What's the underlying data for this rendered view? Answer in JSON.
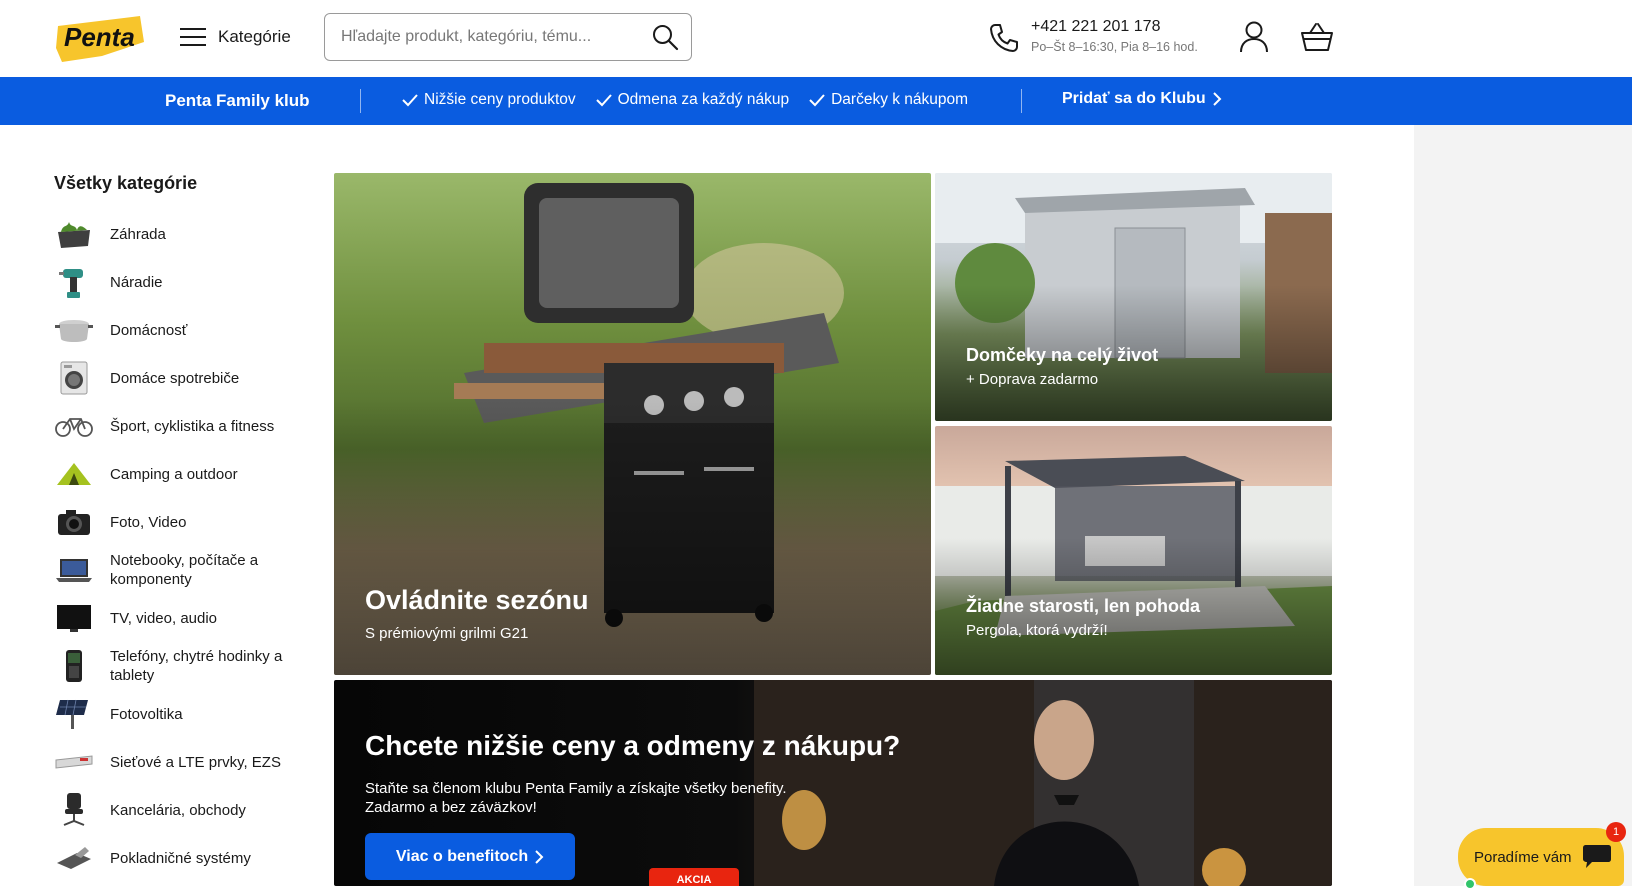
{
  "header": {
    "logo_text": "Penta",
    "menu_label": "Kategórie",
    "search_placeholder": "Hľadajte produkt, kategóriu, tému...",
    "phone_number": "+421 221 201 178",
    "phone_hours": "Po–Št 8–16:30, Pia 8–16 hod."
  },
  "club_bar": {
    "title": "Penta Family klub",
    "benefits": [
      "Nižšie ceny produktov",
      "Odmena za každý nákup",
      "Darčeky k nákupom"
    ],
    "join_label": "Pridať sa do Klubu"
  },
  "sidebar": {
    "title": "Všetky kategórie",
    "items": [
      {
        "label": "Záhrada",
        "icon": "garden-planter-icon"
      },
      {
        "label": "Náradie",
        "icon": "drill-icon"
      },
      {
        "label": "Domácnosť",
        "icon": "pot-icon"
      },
      {
        "label": "Domáce spotrebiče",
        "icon": "washing-machine-icon"
      },
      {
        "label": "Šport, cyklistika a fitness",
        "icon": "bicycle-icon"
      },
      {
        "label": "Camping a outdoor",
        "icon": "tent-icon"
      },
      {
        "label": "Foto, Video",
        "icon": "camera-icon"
      },
      {
        "label": "Notebooky, počítače a komponenty",
        "icon": "laptop-icon"
      },
      {
        "label": "TV, video, audio",
        "icon": "tv-icon"
      },
      {
        "label": "Telefóny, chytré hodinky a tablety",
        "icon": "phone-device-icon"
      },
      {
        "label": "Fotovoltika",
        "icon": "solar-panel-icon"
      },
      {
        "label": "Sieťové a LTE prvky, EZS",
        "icon": "router-icon"
      },
      {
        "label": "Kancelária, obchody",
        "icon": "office-chair-icon"
      },
      {
        "label": "Pokladničné systémy",
        "icon": "cash-register-icon"
      }
    ]
  },
  "banners": {
    "grill": {
      "title": "Ovládnite sezónu",
      "subtitle": "S prémiovými grilmi G21"
    },
    "shed": {
      "title": "Domčeky na celý život",
      "subtitle": "+ Doprava zadarmo"
    },
    "pergola": {
      "title": "Žiadne starosti, len pohoda",
      "subtitle": "Pergola, ktorá vydrží!"
    }
  },
  "promo": {
    "title": "Chcete nižšie ceny a odmeny z nákupu?",
    "text_line1": "Staňte sa členom klubu Penta Family a získajte všetky benefity.",
    "text_line2": "Zadarmo a bez záväzkov!",
    "button_label": "Viac o benefitoch",
    "badge": "AKCIA"
  },
  "chat": {
    "label": "Poradíme vám",
    "unread_count": "1"
  },
  "colors": {
    "brand_blue": "#0a5ce0",
    "brand_yellow": "#f7c52c",
    "badge_red": "#e8250f"
  }
}
